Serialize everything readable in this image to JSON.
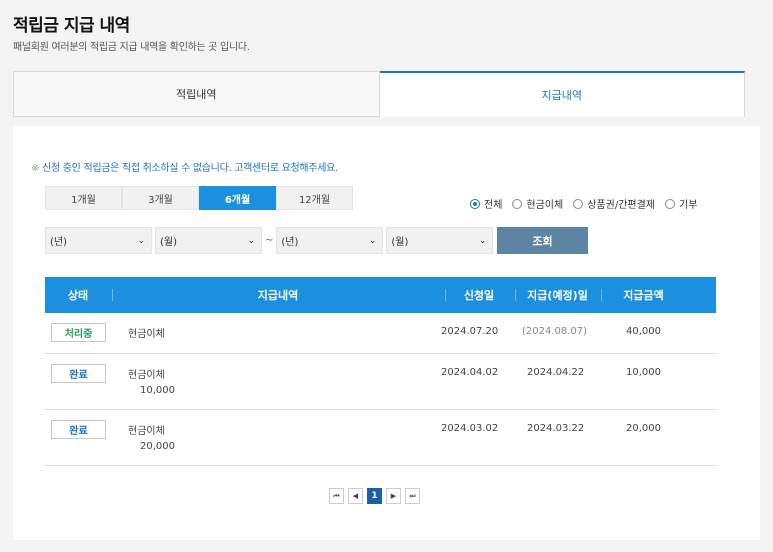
{
  "header": {
    "title": "적립금 지급 내역",
    "subtitle": "패널회원 여러분의 적립금 지급 내역을 확인하는 곳 입니다."
  },
  "tabs": [
    {
      "label": "적립내역",
      "active": false
    },
    {
      "label": "지급내역",
      "active": true
    }
  ],
  "notice": {
    "mark": "※",
    "text": "신청 중인 적립금은 직접 취소하실 수 없습니다. 고객센터로 요청해주세요."
  },
  "periods": [
    {
      "label": "1개월",
      "active": false
    },
    {
      "label": "3개월",
      "active": false
    },
    {
      "label": "6개월",
      "active": true
    },
    {
      "label": "12개월",
      "active": false
    }
  ],
  "filters": [
    {
      "label": "전체",
      "checked": true
    },
    {
      "label": "현금이체",
      "checked": false
    },
    {
      "label": "상품권/간편결제",
      "checked": false
    },
    {
      "label": "기부",
      "checked": false
    }
  ],
  "date_range": {
    "from_year": "(년)",
    "from_month": "(월)",
    "separator": "~",
    "to_year": "(년)",
    "to_month": "(월)",
    "arrow": "⌄"
  },
  "search_label": "조회",
  "table": {
    "headers": [
      "상태",
      "지급내역",
      "신청일",
      "지급(예정)일",
      "지급금액"
    ],
    "rows": [
      {
        "status": "처리중",
        "status_color": "#2e9a5e",
        "type": "현금이체",
        "sub_amount": "",
        "applied": "2024.07.20",
        "paid": "(2024.08.07)",
        "paid_color": "#888888",
        "amount": "40,000"
      },
      {
        "status": "완료",
        "status_color": "#1b73c5",
        "type": "현금이체",
        "sub_amount": "10,000",
        "applied": "2024.04.02",
        "paid": "2024.04.22",
        "paid_color": "#444444",
        "amount": "10,000"
      },
      {
        "status": "완료",
        "status_color": "#1b73c5",
        "type": "현금이체",
        "sub_amount": "20,000",
        "applied": "2024.03.02",
        "paid": "2024.03.22",
        "paid_color": "#444444",
        "amount": "20,000"
      }
    ]
  },
  "pagination": {
    "first": "⏮",
    "prev": "◀",
    "current": "1",
    "next": "▶",
    "last": "⏭"
  },
  "colors": {
    "accent": "#1b8fe0",
    "tab_active": "#1b73c5",
    "search_button": "#5d84a2"
  }
}
